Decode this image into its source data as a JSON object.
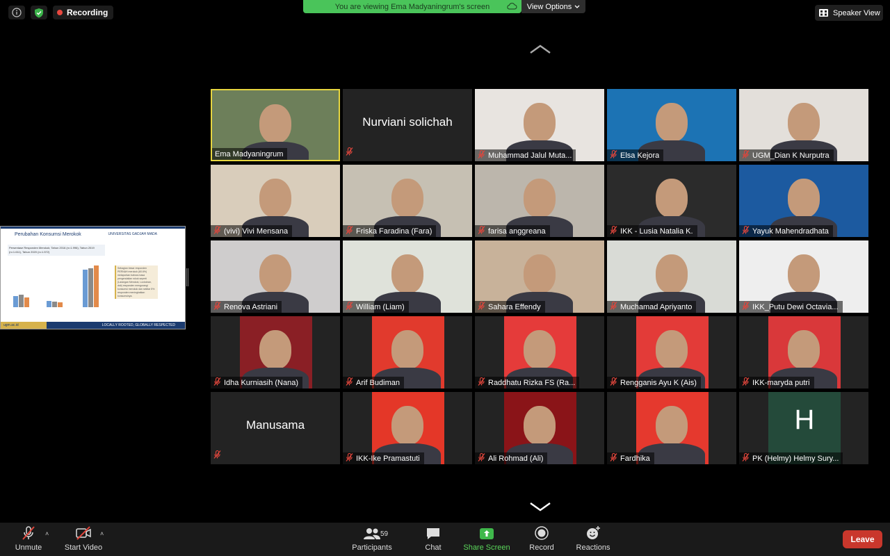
{
  "top": {
    "recording_label": "Recording",
    "viewing_text": "You are viewing Ema Madyaningrum's screen",
    "view_options": "View Options",
    "speaker_view": "Speaker View"
  },
  "shared_slide": {
    "title": "Perubahan Konsumsi Merokok",
    "university": "UNIVERSITAS GADJAH MADA",
    "subhead": "Persentase Responden Merokok; Tahun 2016 (n=1.996), Tahun 2019 (n=1.611), Tahun 2020 (n=1.572)",
    "note": "Sebagian besar responden PERNAH merokok (60.6%) melaporkan bahwa masa pengendalian rokok seperti (Larangan Merokok, Lockdown, dsb) responden mengurangi konsumsi merokok dan sekitar 5% responden meningkatkan konsumsinya.",
    "footer_left": "ugm.ac.id",
    "footer_right": "LOCALLY ROOTED, GLOBALLY RESPECTED"
  },
  "participants": [
    {
      "name": "Ema Madyaningrum",
      "type": "video",
      "bg": "#6d7f5a",
      "active": true,
      "muted": false
    },
    {
      "name": "Nurviani solichah",
      "type": "name-only",
      "muted": true
    },
    {
      "name": "Muhammad Jalul Muta...",
      "type": "video",
      "bg": "#e8e4e0",
      "muted": true
    },
    {
      "name": "Elsa Kejora",
      "type": "video",
      "bg": "#1c73b4",
      "muted": true
    },
    {
      "name": "UGM_Dian K Nurputra",
      "type": "video",
      "bg": "#e3dfda",
      "muted": true
    },
    {
      "name": "(vivi) Vivi Mensana",
      "type": "video",
      "bg": "#d9cdbb",
      "muted": true
    },
    {
      "name": "Friska Faradina (Fara)",
      "type": "video",
      "bg": "#c6c0b3",
      "muted": true
    },
    {
      "name": "farisa anggreana",
      "type": "video",
      "bg": "#bcb6ac",
      "muted": true
    },
    {
      "name": "IKK - Lusia Natalia K.",
      "type": "video",
      "bg": "#2b2b2b",
      "muted": true
    },
    {
      "name": "Yayuk Mahendradhata",
      "type": "video",
      "bg": "#1c5aa0",
      "muted": true
    },
    {
      "name": "Renova Astriani",
      "type": "video",
      "bg": "#cfcdcd",
      "muted": true
    },
    {
      "name": "William (Liam)",
      "type": "video",
      "bg": "#dfe2da",
      "muted": true
    },
    {
      "name": "Sahara Effendy",
      "type": "video",
      "bg": "#c8b29a",
      "muted": true
    },
    {
      "name": "Muchamad Apriyanto",
      "type": "video",
      "bg": "#d9dbd6",
      "muted": true
    },
    {
      "name": "IKK_Putu Dewi Octavia...",
      "type": "video",
      "bg": "#eeeeee",
      "muted": true
    },
    {
      "name": "Idha Kurniasih (Nana)",
      "type": "photo",
      "bg": "#8a1f25",
      "muted": true
    },
    {
      "name": "Arif Budiman",
      "type": "photo",
      "bg": "#e13a2d",
      "muted": true
    },
    {
      "name": "Raddhatu Rizka FS (Ra...",
      "type": "photo",
      "bg": "#e53b3a",
      "muted": true
    },
    {
      "name": "Rengganis Ayu K  (Ais)",
      "type": "photo",
      "bg": "#e33b38",
      "muted": true
    },
    {
      "name": "IKK-maryda putri",
      "type": "photo",
      "bg": "#d9383a",
      "muted": true
    },
    {
      "name": "Manusama",
      "type": "name-only",
      "muted": true
    },
    {
      "name": "IKK-Ike Pramastuti",
      "type": "photo",
      "bg": "#e43728",
      "muted": true
    },
    {
      "name": "Ali Rohmad (Ali)",
      "type": "photo",
      "bg": "#8a1418",
      "muted": true
    },
    {
      "name": "Fardhika",
      "type": "photo",
      "bg": "#e5392e",
      "muted": true
    },
    {
      "name": "PK (Helmy) Helmy Sury...",
      "type": "initial",
      "initial": "H",
      "bg": "#244a3a",
      "muted": true
    }
  ],
  "toolbar": {
    "unmute": "Unmute",
    "start_video": "Start Video",
    "participants": "Participants",
    "participant_count": "59",
    "chat": "Chat",
    "share_screen": "Share Screen",
    "record": "Record",
    "reactions": "Reactions",
    "leave": "Leave"
  },
  "colors": {
    "active_border": "#e7d640",
    "share_green": "#4ac45a",
    "leave_red": "#c9372c",
    "muted_icon": "#e0463c"
  }
}
